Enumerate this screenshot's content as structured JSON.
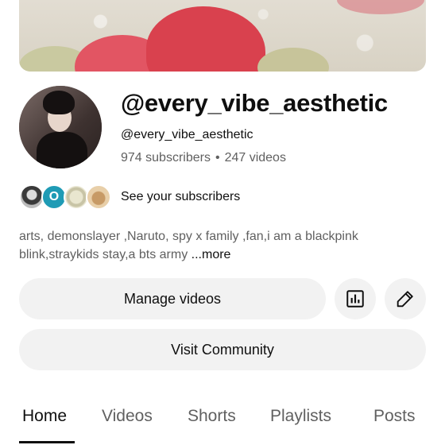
{
  "channel": {
    "title": "@every_vibe_aesthetic",
    "handle": "@every_vibe_aesthetic",
    "subscribers": "974 subscribers",
    "separator": "•",
    "videos": "247 videos"
  },
  "subscribers_row": {
    "second_avatar_letter": "O",
    "label": "See your subscribers"
  },
  "description": {
    "text": "arts, demonslayer ,Naruto, spy x family ,fan,i am a blackpink blink,straykids stay,a bts army ",
    "more_label": "...more"
  },
  "actions": {
    "manage_label": "Manage videos",
    "analytics_icon": "bar-chart-icon",
    "edit_icon": "pencil-icon",
    "community_label": "Visit Community"
  },
  "tabs": [
    {
      "label": "Home",
      "active": true
    },
    {
      "label": "Videos",
      "active": false
    },
    {
      "label": "Shorts",
      "active": false
    },
    {
      "label": "Playlists",
      "active": false
    },
    {
      "label": "Posts",
      "active": false
    }
  ]
}
